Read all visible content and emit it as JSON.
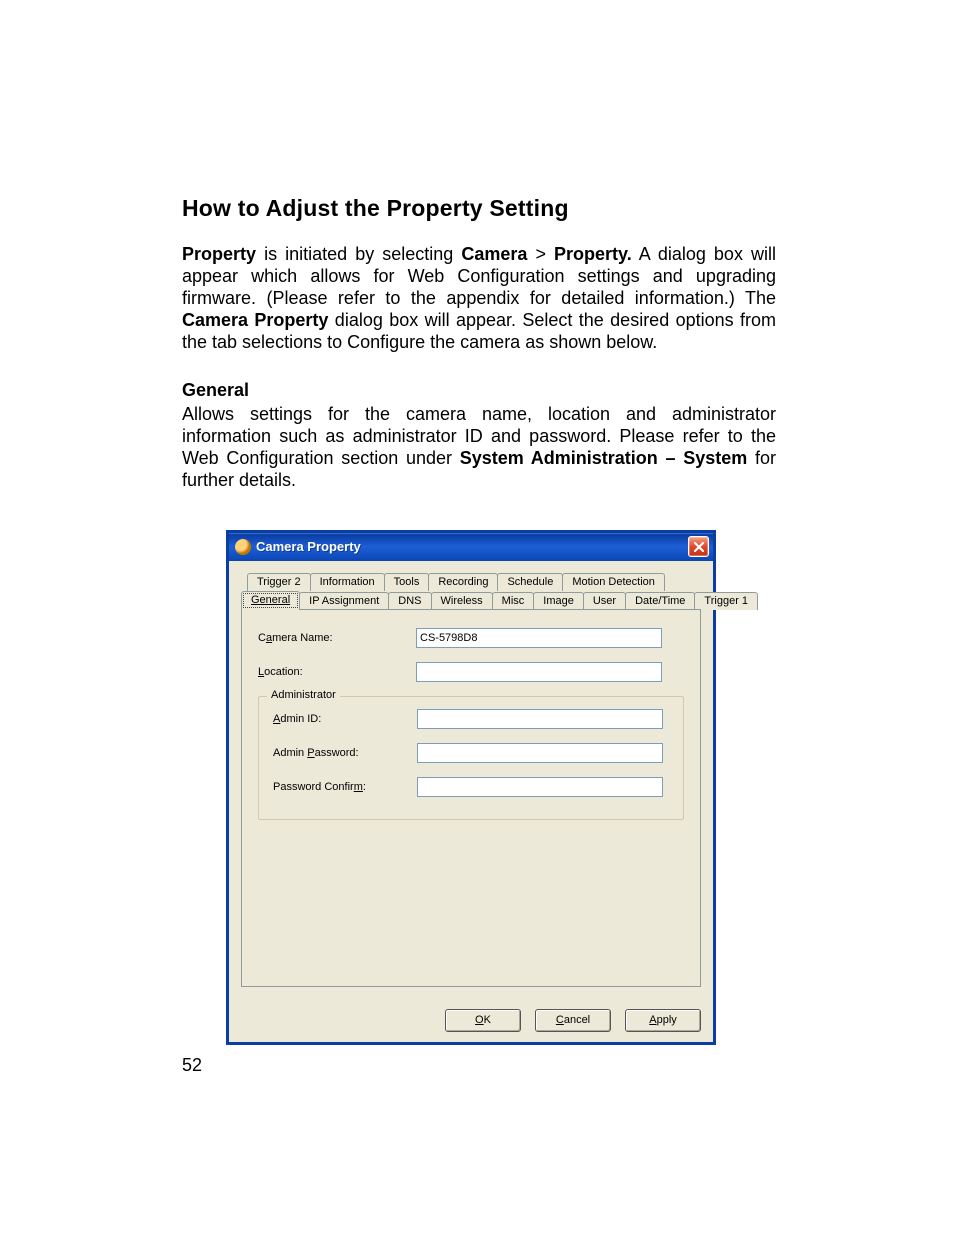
{
  "heading": "How to Adjust the Property Setting",
  "para1": {
    "seg1": "Property",
    "seg2": " is initiated by selecting ",
    "seg3": "Camera",
    "seg4": " > ",
    "seg5": "Property.",
    "seg6": "  A dialog box will appear which allows for Web Configuration settings and upgrading firmware. (Please refer to the appendix for detailed information.) The ",
    "seg7": "Camera Property",
    "seg8": " dialog box will appear.  Select the desired options from the tab selections to Configure the camera as shown below."
  },
  "subhead": "General",
  "para2": {
    "seg1": "Allows settings for the camera name, location and administrator information such as administrator ID and password. Please refer to the Web Configuration section under ",
    "seg2": "System Administration – System",
    "seg3": " for further details."
  },
  "dialog": {
    "title": "Camera Property",
    "tabs_row1": [
      "Trigger 2",
      "Information",
      "Tools",
      "Recording",
      "Schedule",
      "Motion Detection"
    ],
    "tabs_row2": [
      "General",
      "IP Assignment",
      "DNS",
      "Wireless",
      "Misc",
      "Image",
      "User",
      "Date/Time",
      "Trigger 1"
    ],
    "active_tab": "General",
    "fields": {
      "camera_name_label": "Camera Name:",
      "camera_name_value": "CS-5798D8",
      "location_label": "Location:",
      "location_value": "",
      "group_label": "Administrator",
      "admin_id_label": "Admin ID:",
      "admin_id_value": "",
      "admin_pw_label": "Admin Password:",
      "admin_pw_value": "",
      "pw_confirm_label": "Password Confirm:",
      "pw_confirm_value": ""
    },
    "buttons": {
      "ok": "OK",
      "cancel": "Cancel",
      "apply": "Apply"
    }
  },
  "page_number": "52"
}
